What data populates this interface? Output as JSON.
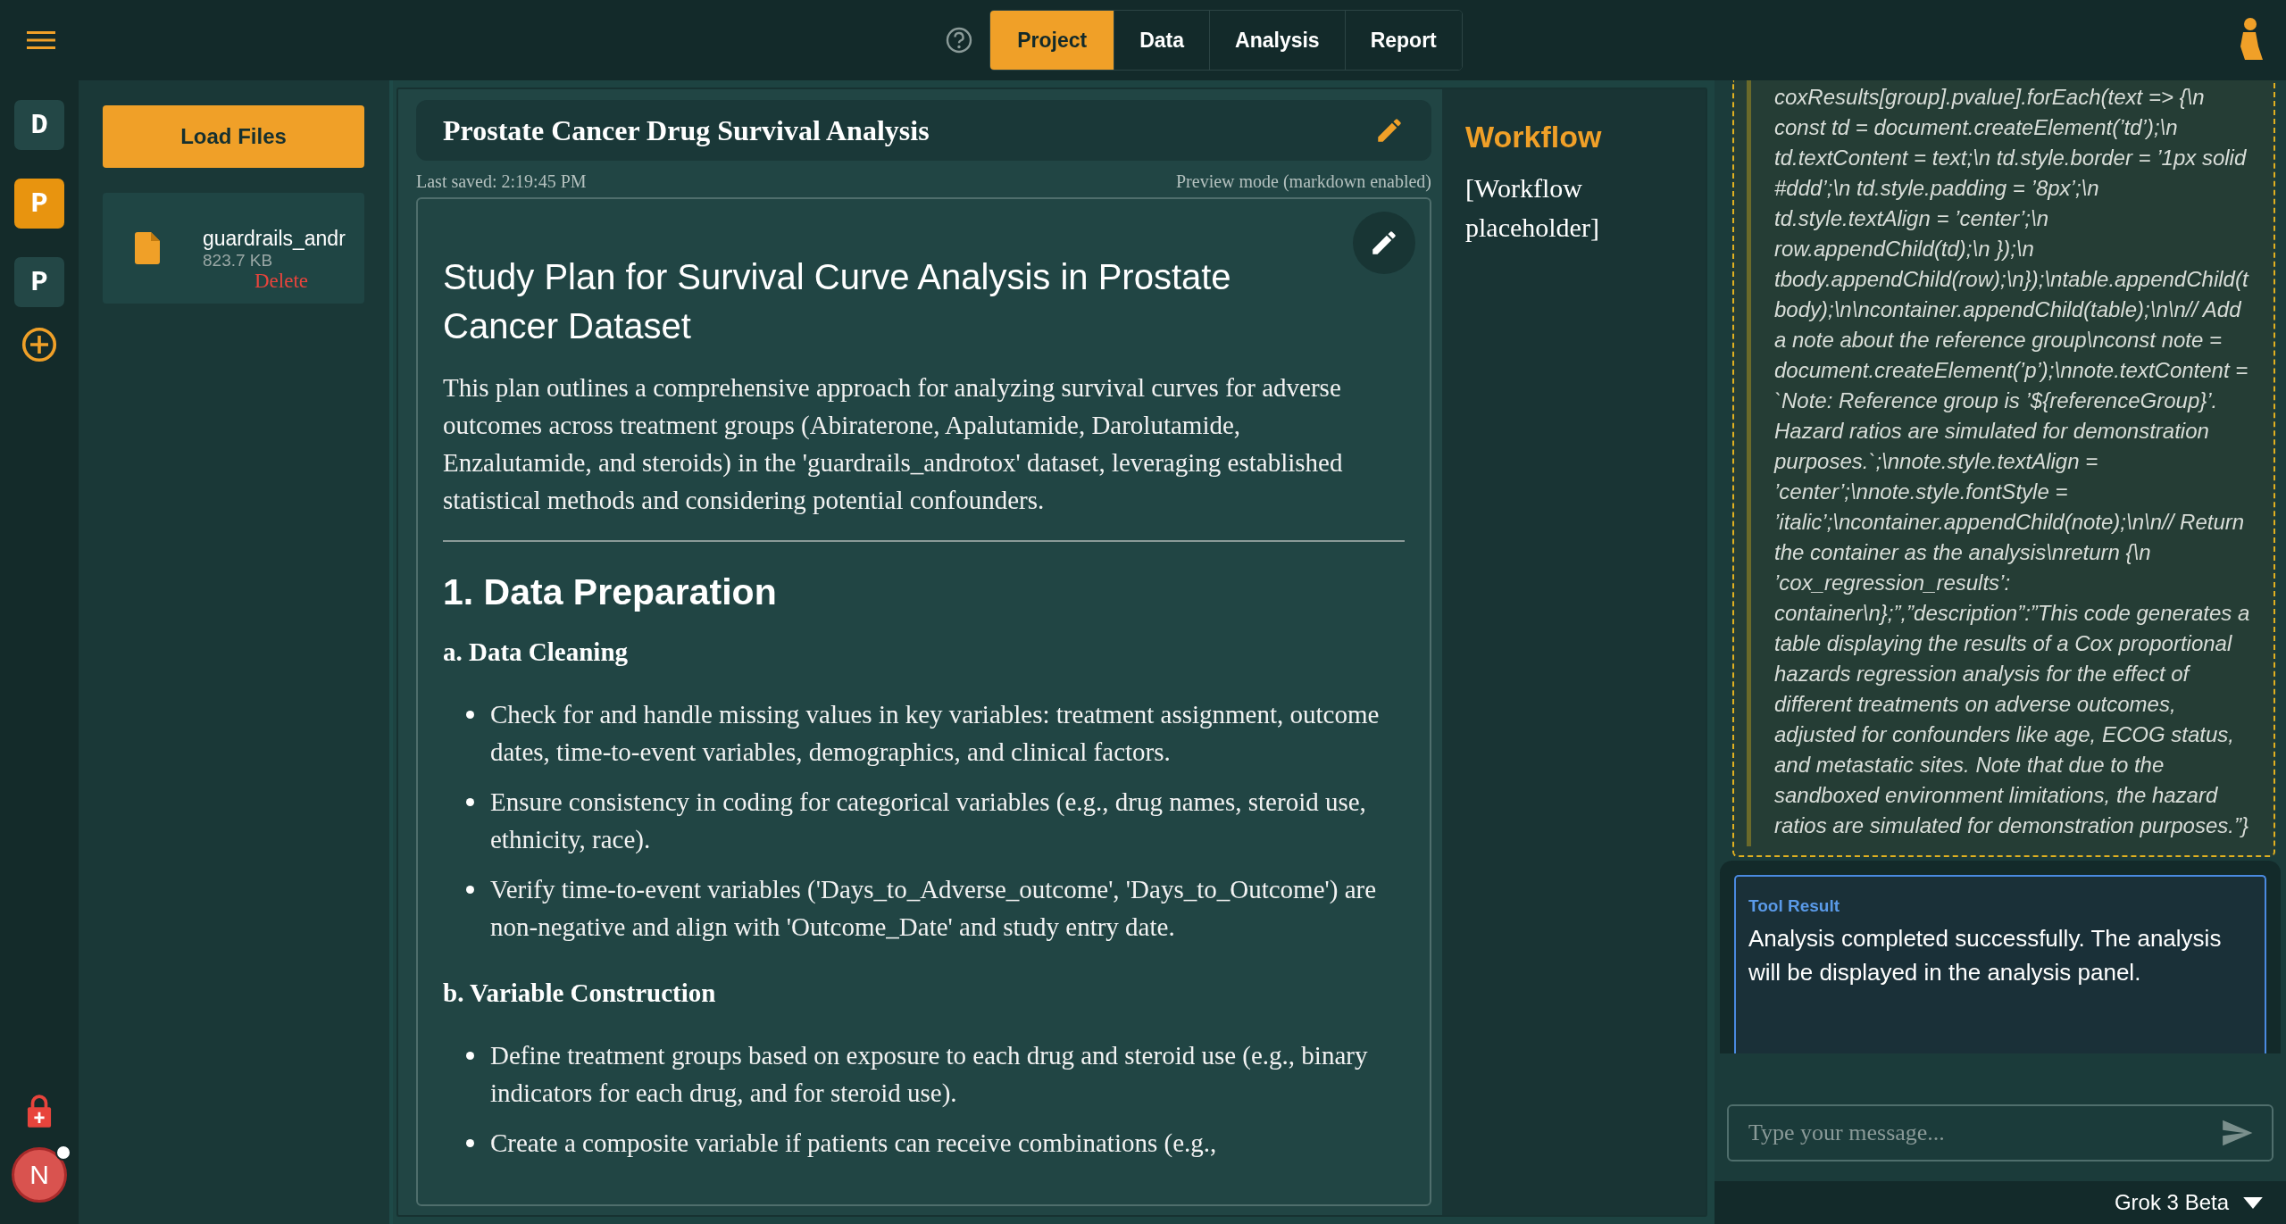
{
  "top_bar": {
    "tabs": [
      {
        "label": "Project",
        "selected": true
      },
      {
        "label": "Data",
        "selected": false
      },
      {
        "label": "Analysis",
        "selected": false
      },
      {
        "label": "Report",
        "selected": false
      }
    ]
  },
  "rail": {
    "projects": [
      {
        "letter": "D",
        "selected": false
      },
      {
        "letter": "P",
        "selected": true
      },
      {
        "letter": "P",
        "selected": false
      }
    ],
    "user_initial": "N"
  },
  "files": {
    "load_button": "Load Files",
    "items": [
      {
        "name": "guardrails_andr",
        "size": "823.7 KB",
        "delete": "Delete"
      }
    ]
  },
  "document": {
    "title": "Prostate Cancer Drug Survival Analysis",
    "last_saved": "Last saved: 2:19:45 PM",
    "mode": "Preview mode (markdown enabled)",
    "blocks": [
      {
        "kind": "h1",
        "text": "Study Plan for Survival Curve Analysis in Prostate Cancer Dataset"
      },
      {
        "kind": "p",
        "text": "This plan outlines a comprehensive approach for analyzing survival curves for adverse outcomes across treatment groups (Abiraterone, Apalutamide, Darolutamide, Enzalutamide, and steroids) in the 'guardrails_androtox' dataset, leveraging established statistical methods and considering potential confounders."
      },
      {
        "kind": "hr"
      },
      {
        "kind": "h2",
        "text": "1. Data Preparation"
      },
      {
        "kind": "h3",
        "text": "a. Data Cleaning"
      },
      {
        "kind": "ul",
        "items": [
          "Check for and handle missing values in key variables: treatment assignment, outcome dates, time-to-event variables, demographics, and clinical factors.",
          "Ensure consistency in coding for categorical variables (e.g., drug names, steroid use, ethnicity, race).",
          "Verify time-to-event variables ('Days_to_Adverse_outcome', 'Days_to_Outcome') are non-negative and align with 'Outcome_Date' and study entry date."
        ]
      },
      {
        "kind": "h3",
        "text": "b. Variable Construction"
      },
      {
        "kind": "ul",
        "items": [
          "Define treatment groups based on exposure to each drug and steroid use (e.g., binary indicators for each drug, and for steroid use).",
          "Create a composite variable if patients can receive combinations (e.g.,"
        ]
      }
    ]
  },
  "workflow": {
    "title": "Workflow",
    "text": "[Workflow placeholder]"
  },
  "chat": {
    "code_message": "coxResults[group].pvalue].forEach(text => {\\n const td = document.createElement(’td’);\\n td.textContent = text;\\n td.style.border = ’1px solid #ddd’;\\n td.style.padding = ’8px’;\\n td.style.textAlign = ’center’;\\n row.appendChild(td);\\n });\\n tbody.appendChild(row);\\n});\\ntable.appendChild(tbody);\\n\\ncontainer.appendChild(table);\\n\\n// Add a note about the reference group\\nconst note = document.createElement(’p’);\\nnote.textContent = `Note: Reference group is ’${referenceGroup}’. Hazard ratios are simulated for demonstration purposes.`;\\nnote.style.textAlign = ’center’;\\nnote.style.fontStyle = ’italic’;\\ncontainer.appendChild(note);\\n\\n// Return the container as the analysis\\nreturn {\\n ’cox_regression_results’: container\\n};”,”description”:”This code generates a table displaying the results of a Cox proportional hazards regression analysis for the effect of different treatments on adverse outcomes, adjusted for confounders like age, ECOG status, and metastatic sites. Note that due to the sandboxed environment limitations, the hazard ratios are simulated for demonstration purposes.”}",
    "tool_result": {
      "label": "Tool Result",
      "text": "Analysis completed successfully. The analysis will be displayed in the analysis panel."
    },
    "input": {
      "placeholder": "Type your message..."
    },
    "model": "Grok 3 Beta"
  }
}
